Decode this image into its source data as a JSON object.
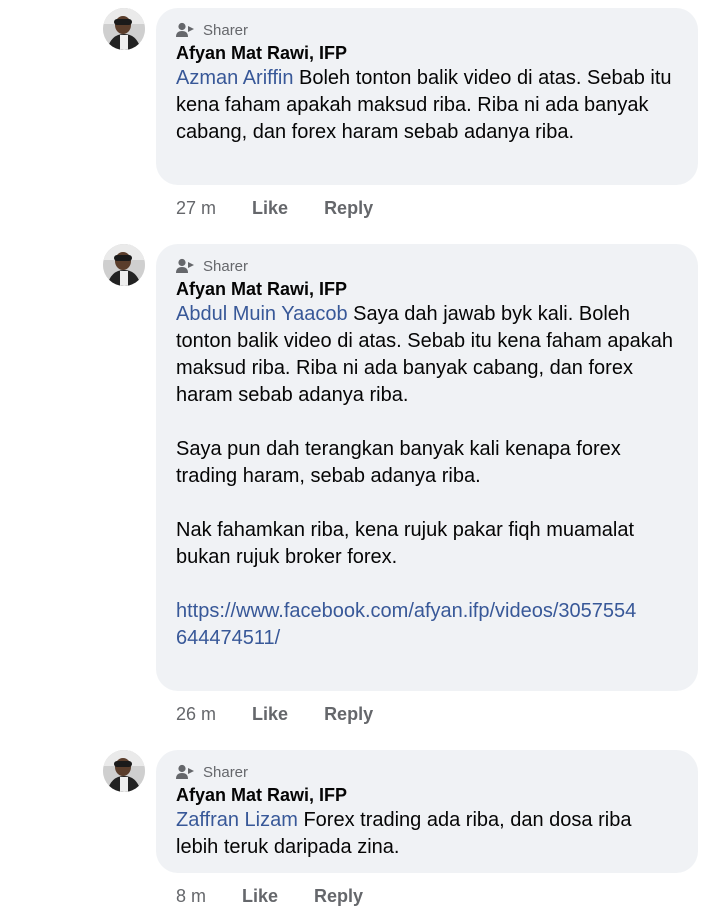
{
  "comments": [
    {
      "badge": "Sharer",
      "badge_icon": "sharer-icon",
      "author": "Afyan Mat Rawi, IFP",
      "mention": "Azman Ariffin",
      "text": " Boleh tonton balik video di atas. Sebab itu kena faham apakah maksud riba. Riba ni ada banyak cabang, dan forex haram sebab adanya riba.",
      "time": "27 m",
      "like": "Like",
      "reply": "Reply"
    },
    {
      "badge": "Sharer",
      "badge_icon": "sharer-icon",
      "author": "Afyan Mat Rawi, IFP",
      "mention": "Abdul Muin Yaacob",
      "text": " Saya dah jawab byk kali. Boleh tonton balik video di atas. Sebab itu kena faham apakah maksud riba. Riba ni ada banyak cabang, dan forex haram sebab adanya riba.",
      "para2": "Saya pun dah terangkan banyak kali kenapa forex trading haram, sebab adanya riba.",
      "para3": "Nak fahamkan riba, kena rujuk pakar fiqh muamalat bukan rujuk broker forex.",
      "link": "https://www.facebook.com/afyan.ifp/videos/3057554644474511/",
      "time": "26 m",
      "like": "Like",
      "reply": "Reply"
    },
    {
      "badge": "Sharer",
      "badge_icon": "sharer-icon",
      "author": "Afyan Mat Rawi, IFP",
      "mention": "Zaffran Lizam",
      "text": " Forex trading ada riba, dan dosa riba lebih teruk daripada zina.",
      "time": "8 m",
      "like": "Like",
      "reply": "Reply"
    }
  ],
  "colors": {
    "bubble": "#f0f2f5",
    "link": "#385898",
    "meta": "#65676b"
  }
}
